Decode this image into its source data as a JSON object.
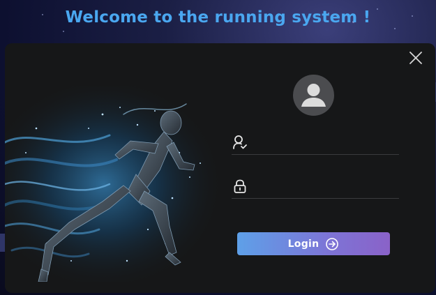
{
  "page": {
    "welcome_text": "Welcome to the running system !"
  },
  "login_dialog": {
    "username": {
      "value": "",
      "placeholder": "",
      "icon": "user-check-icon"
    },
    "password": {
      "value": "",
      "placeholder": "",
      "icon": "lock-icon"
    },
    "login_button": {
      "label": "Login",
      "icon": "arrow-right-circle-icon"
    },
    "close_icon": "close-icon",
    "avatar_icon": "user-avatar-icon",
    "illustration": "runner-illustration"
  },
  "colors": {
    "welcome_text": "#4aa7f0",
    "modal_background": "#161718",
    "button_gradient_start": "#5ea0e8",
    "button_gradient_end": "#8a62c8",
    "avatar_background": "#4b4c4f",
    "background": "#0d1030"
  }
}
